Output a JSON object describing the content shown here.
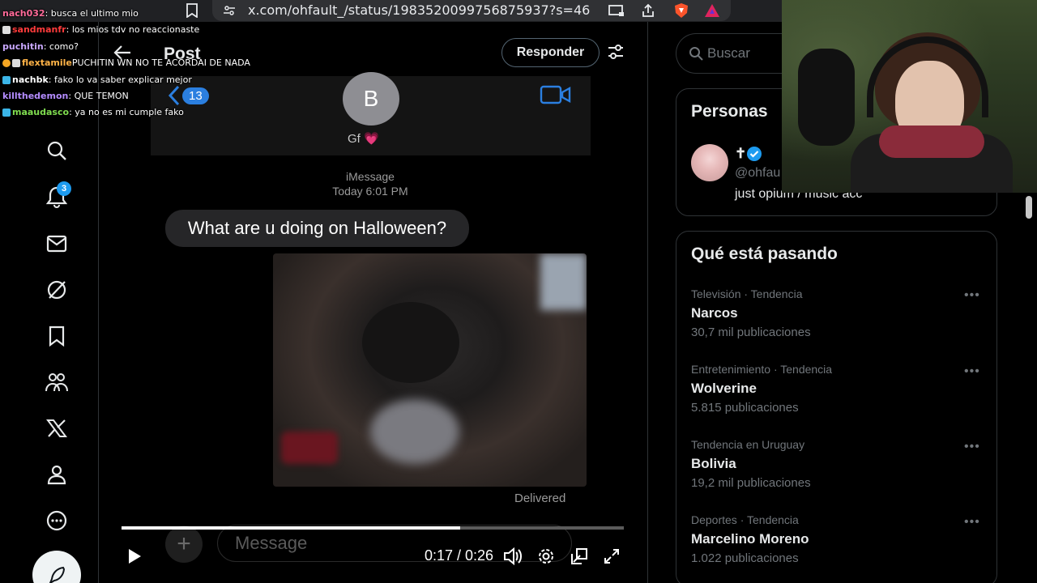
{
  "browser": {
    "url": "x.com/ohfault_/status/1983520099756875937?s=46"
  },
  "nav": {
    "notifications_count": "3"
  },
  "header": {
    "title": "Post",
    "reply_label": "Responder"
  },
  "video": {
    "imessage": {
      "back_count": "13",
      "contact_initial": "B",
      "contact_name": "Gf 💗",
      "service": "iMessage",
      "timestamp": "Today 6:01 PM",
      "bubble_text": "What are u doing on Halloween?",
      "delivered": "Delivered",
      "input_placeholder": "Message"
    },
    "time": "0:17 / 0:26",
    "progress": 0.674
  },
  "right": {
    "search_placeholder": "Buscar",
    "people_title": "Personas",
    "person": {
      "name": "✝",
      "handle": "@ohfau",
      "bio": "just opium / music acc"
    },
    "trends_title": "Qué está pasando",
    "trends": [
      {
        "category": "Televisión · Tendencia",
        "name": "Narcos",
        "count": "30,7 mil publicaciones"
      },
      {
        "category": "Entretenimiento · Tendencia",
        "name": "Wolverine",
        "count": "5.815 publicaciones"
      },
      {
        "category": "Tendencia en Uruguay",
        "name": "Bolivia",
        "count": "19,2 mil publicaciones"
      },
      {
        "category": "Deportes · Tendencia",
        "name": "Marcelino Moreno",
        "count": "1.022 publicaciones"
      }
    ]
  },
  "chat": [
    {
      "user": "nach032",
      "msg": "busca el ultimo mio",
      "color": "#ff6b9a"
    },
    {
      "user": "sandmanfr",
      "msg": "los mios tdv no reaccionaste",
      "color": "#ff3b3b"
    },
    {
      "user": "puchitin",
      "msg": "como?",
      "color": "#c9a8ff"
    },
    {
      "user": "flextamile",
      "msg": "PUCHITIN WN NO TE ACORDAI DE NADA",
      "color": "#ffb347"
    },
    {
      "user": "nachbk",
      "msg": "fako lo va saber explicar mejor",
      "color": "#ffffff"
    },
    {
      "user": "killthedemon",
      "msg": "QUE TEMON",
      "color": "#b48cff"
    },
    {
      "user": "maaudasco",
      "msg": "ya no es mi cumple fako",
      "color": "#7fdc4f"
    }
  ]
}
